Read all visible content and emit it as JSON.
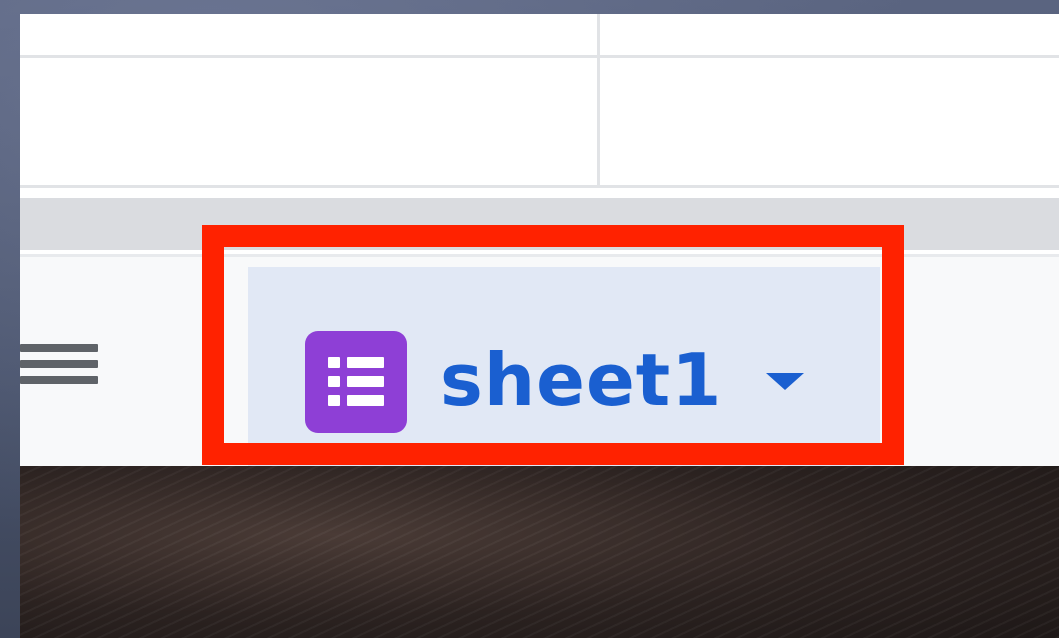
{
  "sheet_tabs": {
    "active": {
      "name": "sheet1",
      "icon": "form-icon",
      "icon_color": "#8e3fd6",
      "text_color": "#1a5fd0",
      "background": "#e1e8f5"
    },
    "all_sheets_icon": "hamburger-menu-icon"
  },
  "annotation": {
    "color": "#ff2200"
  }
}
